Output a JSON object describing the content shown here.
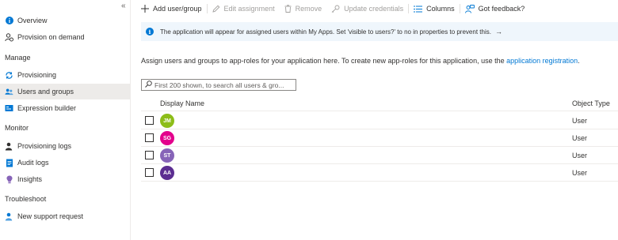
{
  "sidebar": {
    "collapse_glyph": "«",
    "items_top": [
      {
        "label": "Overview",
        "icon": "info-icon"
      },
      {
        "label": "Provision on demand",
        "icon": "person-provision-icon"
      }
    ],
    "sections": [
      {
        "heading": "Manage",
        "items": [
          {
            "label": "Provisioning",
            "icon": "sync-icon"
          },
          {
            "label": "Users and groups",
            "icon": "users-icon",
            "active": true
          },
          {
            "label": "Expression builder",
            "icon": "expression-icon"
          }
        ]
      },
      {
        "heading": "Monitor",
        "items": [
          {
            "label": "Provisioning logs",
            "icon": "person-log-icon"
          },
          {
            "label": "Audit logs",
            "icon": "audit-log-icon"
          },
          {
            "label": "Insights",
            "icon": "lightbulb-icon"
          }
        ]
      },
      {
        "heading": "Troubleshoot",
        "items": [
          {
            "label": "New support request",
            "icon": "support-person-icon"
          }
        ]
      }
    ]
  },
  "toolbar": {
    "add_label": "Add user/group",
    "edit_label": "Edit assignment",
    "remove_label": "Remove",
    "update_label": "Update credentials",
    "columns_label": "Columns",
    "feedback_label": "Got feedback?"
  },
  "banner": {
    "text": "The application will appear for assigned users within My Apps. Set 'visible to users?' to no in properties to prevent this.",
    "arrow": "→"
  },
  "description": {
    "text": "Assign users and groups to app-roles for your application here. To create new app-roles for this application, use the",
    "link": "application registration",
    "suffix": "."
  },
  "search": {
    "placeholder": "First 200 shown, to search all users & gro..."
  },
  "table": {
    "columns": [
      "Display Name",
      "Object Type"
    ],
    "rows": [
      {
        "initials": "JM",
        "color": "#8cbd18",
        "type": "User"
      },
      {
        "initials": "SG",
        "color": "#e3008c",
        "type": "User"
      },
      {
        "initials": "ST",
        "color": "#8764b8",
        "type": "User"
      },
      {
        "initials": "AA",
        "color": "#5c2e91",
        "type": "User"
      }
    ]
  },
  "colors": {
    "accent": "#0078d4",
    "banner_bg": "#eff6fc",
    "active_nav": "#edebe9"
  }
}
